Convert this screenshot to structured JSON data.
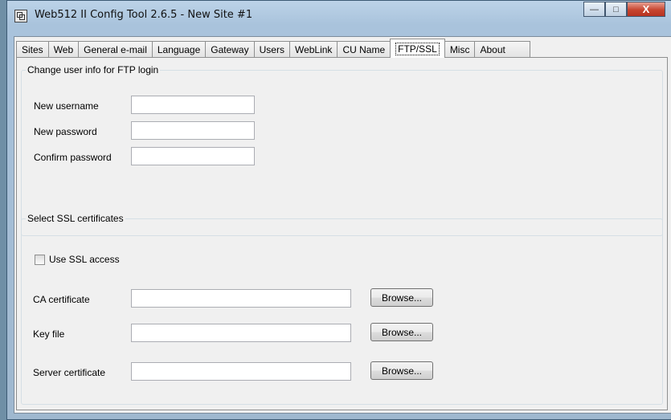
{
  "window": {
    "title": "Web512 II Config Tool 2.6.5 - New Site #1",
    "caption": {
      "minimize": "—",
      "maximize": "□",
      "close": "X"
    }
  },
  "tabs": [
    {
      "label": "Sites",
      "active": false
    },
    {
      "label": "Web",
      "active": false
    },
    {
      "label": "General e-mail",
      "active": false
    },
    {
      "label": "Language",
      "active": false
    },
    {
      "label": "Gateway",
      "active": false
    },
    {
      "label": "Users",
      "active": false
    },
    {
      "label": "WebLink",
      "active": false
    },
    {
      "label": "CU Name",
      "active": false
    },
    {
      "label": "FTP/SSL",
      "active": true
    },
    {
      "label": "Misc",
      "active": false
    },
    {
      "label": "About",
      "active": false
    }
  ],
  "ftp": {
    "legend": "Change user info for FTP login",
    "username_label": "New username",
    "username_value": "",
    "password_label": "New password",
    "password_value": "",
    "confirm_label": "Confirm password",
    "confirm_value": ""
  },
  "ssl": {
    "legend": "Select SSL certificates",
    "use_ssl_label": "Use SSL access",
    "use_ssl_checked": false,
    "ca_label": "CA certificate",
    "ca_value": "",
    "key_label": "Key file",
    "key_value": "",
    "server_label": "Server certificate",
    "server_value": "",
    "browse_label": "Browse..."
  }
}
